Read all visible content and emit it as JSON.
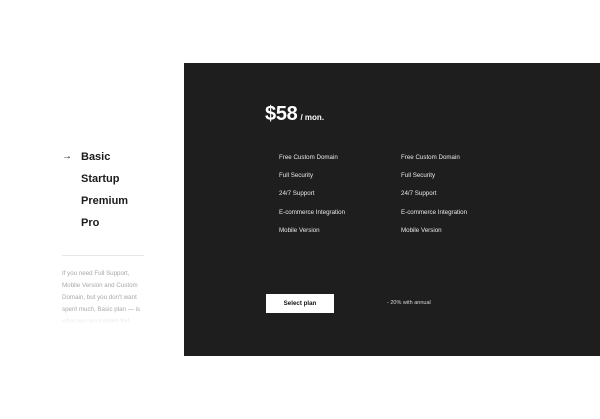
{
  "plans": {
    "items": [
      {
        "label": "Basic",
        "selected": true
      },
      {
        "label": "Startup",
        "selected": false
      },
      {
        "label": "Premium",
        "selected": false
      },
      {
        "label": "Pro",
        "selected": false
      }
    ],
    "selected_indicator": "→",
    "description": "If you need Full Support, Mobile Version and Custom Domain, but you don't want spent much, Basic plan — is what you are looking for!"
  },
  "card": {
    "price": "$58",
    "period": "/ mon.",
    "features_left": [
      "Free Custom Domain",
      "Full Security",
      "24/7 Support",
      "E-commerce Integration",
      "Mobile Version"
    ],
    "features_right": [
      "Free Custom Domain",
      "Full Security",
      "24/7 Support",
      "E-commerce Integration",
      "Mobile Version"
    ],
    "button_label": "Select plan",
    "discount_note": "- 20% with annual"
  },
  "colors": {
    "card_background": "#1e1e1e",
    "text_dark": "#1b1b1b",
    "text_muted": "#a8a8a8",
    "button_background": "#ffffff"
  },
  "icons": {
    "selected_indicator": "arrow-right-icon"
  }
}
